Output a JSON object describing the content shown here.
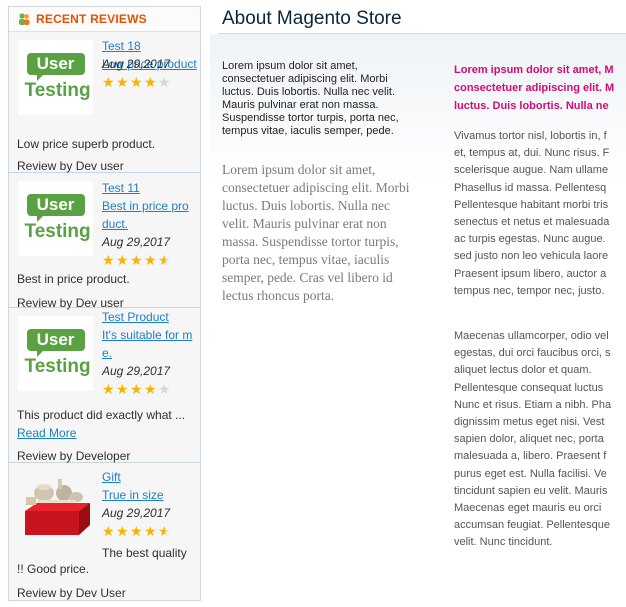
{
  "sidebar": {
    "title": "RECENT REVIEWS",
    "reviews": [
      {
        "product": "Test 18",
        "title_lines": [
          "Low price product",
          "ct"
        ],
        "date": "Aug 29,2017",
        "rating": 4,
        "text": "Low price superb product.",
        "by": "Review by Dev user",
        "image": "usertesting-logo"
      },
      {
        "product": "Test 11",
        "title_lines": [
          "Best in price pro",
          "duct."
        ],
        "date": "Aug 29,2017",
        "rating": 4.5,
        "text": "Best in price product.",
        "by": "Review by Dev user",
        "image": "usertesting-logo"
      },
      {
        "product": "Test Product",
        "title_lines": [
          "It's suitable for m",
          "e."
        ],
        "date": "Aug 29,2017",
        "rating": 4,
        "text": "This product did exactly what ...",
        "read_more": "Read More",
        "by": "Review by Developer",
        "image": "usertesting-logo"
      },
      {
        "product": "Gift",
        "title_lines": [
          "True in size"
        ],
        "date": "Aug 29,2017",
        "rating": 4.5,
        "text_lines": [
          "The best quality",
          "!! Good price."
        ],
        "by": "Review by Dev User",
        "image": "gift-box-photo"
      }
    ],
    "logo": {
      "top": "User",
      "bottom": "Testing"
    }
  },
  "main": {
    "title": "About Magento Store",
    "col1_para1": [
      "Lorem ipsum dolor sit amet,",
      "consectetuer adipiscing elit. Morbi",
      "luctus. Duis lobortis. Nulla nec velit.",
      "Mauris pulvinar erat non massa.",
      "Suspendisse tortor turpis, porta nec,",
      "tempus vitae, iaculis semper, pede."
    ],
    "col1_para2": [
      "Lorem ipsum dolor sit amet,",
      "consectetuer adipiscing elit. Morbi",
      "luctus. Duis lobortis. Nulla nec",
      "velit. Mauris pulvinar erat non",
      "massa. Suspendisse tortor turpis,",
      "porta nec, tempus vitae, iaculis",
      "semper, pede. Cras vel libero id",
      "lectus rhoncus porta."
    ],
    "col2_highlight": [
      "Lorem ipsum dolor sit amet, M",
      "consectetuer adipiscing elit. M",
      "luctus. Duis lobortis. Nulla ne"
    ],
    "col2_para1": [
      "Vivamus tortor nisl, lobortis in, f",
      "et, tempus at, dui. Nunc risus. F",
      "scelerisque augue. Nam ullame",
      "Phasellus id massa. Pellentesq",
      "Pellentesque habitant morbi tris",
      "senectus et netus et malesuada",
      "ac turpis egestas. Nunc augue.",
      "sed justo non leo vehicula laore",
      "Praesent ipsum libero, auctor a",
      "tempus nec, tempor nec, justo."
    ],
    "col2_para2": [
      "Maecenas ullamcorper, odio vel",
      "egestas, dui orci faucibus orci, s",
      "aliquet lectus dolor et quam.",
      "Pellentesque consequat luctus",
      "Nunc et risus. Etiam a nibh. Pha",
      "dignissim metus eget nisi. Vest",
      "sapien dolor, aliquet nec, porta",
      "malesuada a, libero. Praesent f",
      "purus eget est. Nulla facilisi. Ve",
      "tincidunt sapien eu velit. Mauris",
      "Maecenas eget mauris eu orci",
      "accumsan feugiat. Pellentesque",
      "velit. Nunc tincidunt."
    ]
  }
}
